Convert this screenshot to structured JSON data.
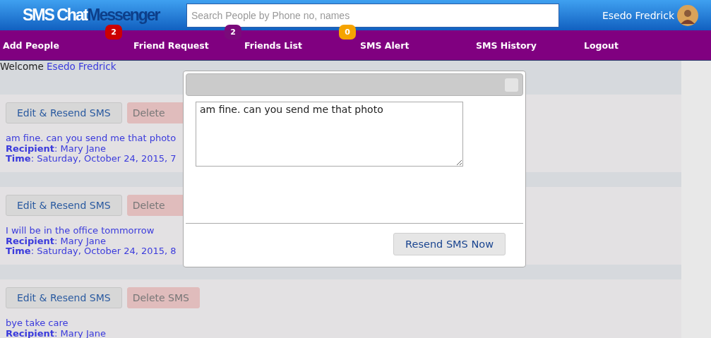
{
  "header": {
    "logo_part_1": "SMS Chat",
    "logo_part_2": "Messenger",
    "search": {
      "placeholder": "Search People by Phone no, names"
    },
    "user_name": "Esedo Fredrick"
  },
  "nav": [
    {
      "label": "Add People"
    },
    {
      "label": "Friend Request",
      "badge": "2",
      "color": "#cc0000"
    },
    {
      "label": "Friends List",
      "badge": "2",
      "color": "#7a0a7a"
    },
    {
      "label": "SMS Alert",
      "badge": "0",
      "color": "#f5a300"
    },
    {
      "label": "SMS History"
    },
    {
      "label": "Logout"
    }
  ],
  "welcome": {
    "text": "Welcome",
    "name": "Esedo Fredrick"
  },
  "messages": [
    {
      "edit_button": "Edit & Resend SMS",
      "delete_button": "Delete",
      "text": "am fine. can you send me that photo",
      "recipient_label": "Recipient",
      "recipient": ": Mary Jane",
      "time_label": "Time",
      "time": ": Saturday, October 24, 2015, 7"
    },
    {
      "edit_button": "Edit & Resend SMS",
      "delete_button": "Delete",
      "text": "I will be in the office tommorrow",
      "recipient_label": "Recipient",
      "recipient": ": Mary Jane",
      "time_label": "Time",
      "time": ": Saturday, October 24, 2015, 8"
    },
    {
      "edit_button": "Edit & Resend SMS",
      "delete_button": "Delete SMS",
      "text": "bye take care",
      "recipient_label": "Recipient",
      "recipient": ": Mary Jane"
    }
  ],
  "modal": {
    "message": "am fine. can you send me that photo",
    "button": "Resend SMS Now"
  }
}
